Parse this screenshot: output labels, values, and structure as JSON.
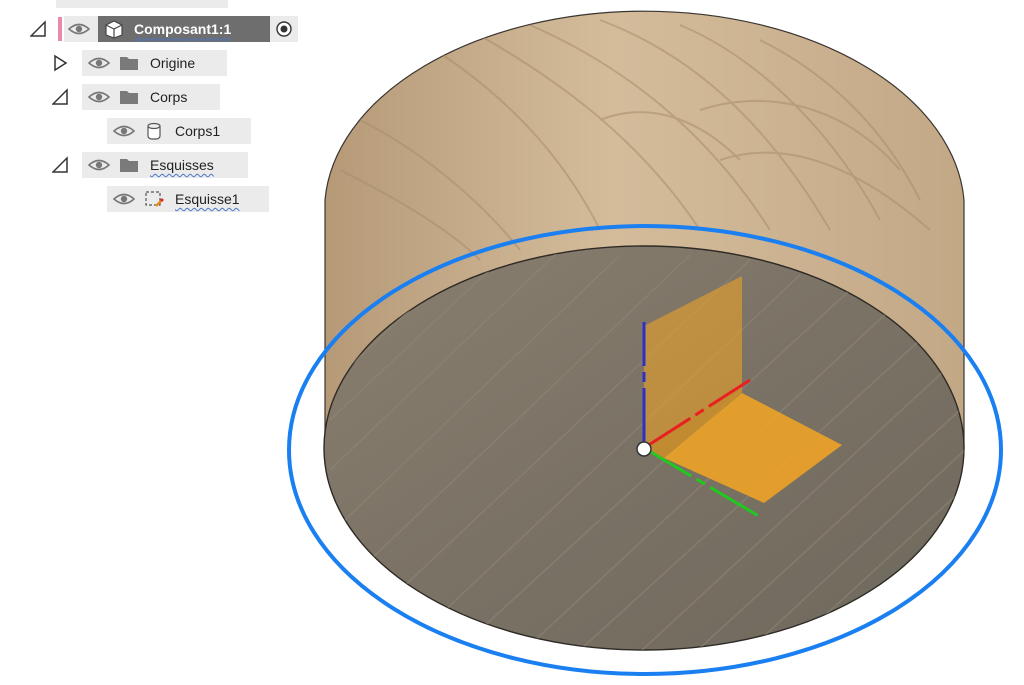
{
  "browser": {
    "component": {
      "label": "Composant1:1"
    },
    "items": [
      {
        "label": "Origine"
      },
      {
        "label": "Corps"
      },
      {
        "label": "Corps1"
      },
      {
        "label": "Esquisses"
      },
      {
        "label": "Esquisse1"
      }
    ]
  },
  "viewport": {
    "selection_color": "#1a7ff0",
    "axis_colors": {
      "x": "#e82020",
      "y": "#20c820",
      "z": "#3030c8"
    },
    "plane_color": "#f5a623"
  }
}
